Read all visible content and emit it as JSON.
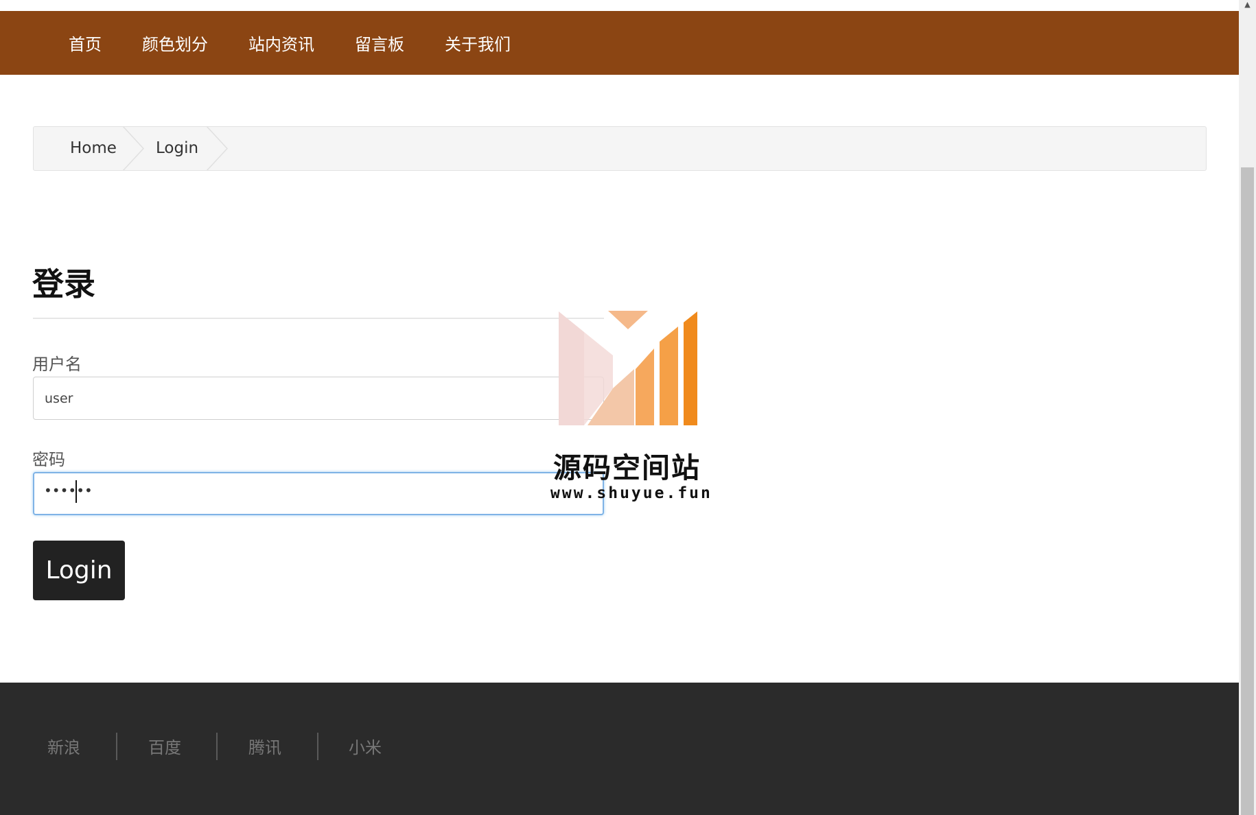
{
  "nav": {
    "items": [
      {
        "label": "首页"
      },
      {
        "label": "颜色划分"
      },
      {
        "label": "站内资讯"
      },
      {
        "label": "留言板"
      },
      {
        "label": "关于我们"
      }
    ]
  },
  "breadcrumb": {
    "items": [
      {
        "label": "Home"
      },
      {
        "label": "Login"
      }
    ]
  },
  "form": {
    "title": "登录",
    "username_label": "用户名",
    "username_value": "user",
    "password_label": "密码",
    "password_masked": "••••••",
    "submit_label": "Login"
  },
  "watermark": {
    "title": "源码空间站",
    "url": "www.shuyue.fun"
  },
  "footer": {
    "links": [
      {
        "label": "新浪"
      },
      {
        "label": "百度"
      },
      {
        "label": "腾讯"
      },
      {
        "label": "小米"
      }
    ]
  },
  "colors": {
    "navbar": "#8b4513",
    "footer": "#2b2b2b",
    "button": "#222222",
    "watermark_orange": "#f08a1c"
  },
  "icons": {
    "scroll_up": "scroll-up-arrow-icon"
  }
}
